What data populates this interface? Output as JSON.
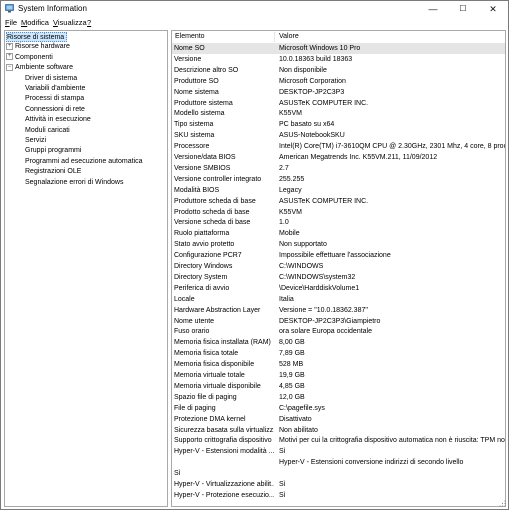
{
  "window": {
    "title": "System Information",
    "min": "—",
    "max": "☐",
    "close": "✕"
  },
  "menu": [
    {
      "u": "F",
      "rest": "ile"
    },
    {
      "u": "M",
      "rest": "odifica"
    },
    {
      "u": "V",
      "rest": "isualizza"
    },
    {
      "u": "?",
      "rest": ""
    }
  ],
  "tree": [
    {
      "label": "Risorse di sistema",
      "level": 0,
      "exp": "",
      "sel": true
    },
    {
      "label": "Risorse hardware",
      "level": 0,
      "exp": "+"
    },
    {
      "label": "Componenti",
      "level": 0,
      "exp": "+"
    },
    {
      "label": "Ambiente software",
      "level": 0,
      "exp": "−"
    },
    {
      "label": "Driver di sistema",
      "level": 1
    },
    {
      "label": "Variabili d'ambiente",
      "level": 1
    },
    {
      "label": "Processi di stampa",
      "level": 1
    },
    {
      "label": "Connessioni di rete",
      "level": 1
    },
    {
      "label": "Attività in esecuzione",
      "level": 1
    },
    {
      "label": "Moduli caricati",
      "level": 1
    },
    {
      "label": "Servizi",
      "level": 1
    },
    {
      "label": "Gruppi programmi",
      "level": 1
    },
    {
      "label": "Programmi ad esecuzione automatica",
      "level": 1
    },
    {
      "label": "Registrazioni OLE",
      "level": 1
    },
    {
      "label": "Segnalazione errori di Windows",
      "level": 1
    }
  ],
  "columns": {
    "key": "Elemento",
    "value": "Valore"
  },
  "rows": [
    [
      "Nome SO",
      "Microsoft Windows 10 Pro"
    ],
    [
      "Versione",
      "10.0.18363 build 18363"
    ],
    [
      "Descrizione altro SO",
      "Non disponibile"
    ],
    [
      "Produttore SO",
      "Microsoft Corporation"
    ],
    [
      "Nome sistema",
      "DESKTOP-JP2C3P3"
    ],
    [
      "Produttore sistema",
      "ASUSTeK COMPUTER INC."
    ],
    [
      "Modello sistema",
      "K55VM"
    ],
    [
      "Tipo sistema",
      "PC basato su x64"
    ],
    [
      "SKU sistema",
      "ASUS-NotebookSKU"
    ],
    [
      "Processore",
      "Intel(R) Core(TM) i7-3610QM CPU @ 2.30GHz, 2301 Mhz, 4 core, 8 proce"
    ],
    [
      "Versione/data BIOS",
      "American Megatrends Inc. K55VM.211, 11/09/2012"
    ],
    [
      "Versione SMBIOS",
      "2.7"
    ],
    [
      "Versione controller integrato",
      "255.255"
    ],
    [
      "Modalità BIOS",
      "Legacy"
    ],
    [
      "Produttore scheda di base",
      "ASUSTeK COMPUTER INC."
    ],
    [
      "Prodotto scheda di base",
      "K55VM"
    ],
    [
      "Versione scheda di base",
      "1.0"
    ],
    [
      "Ruolo piattaforma",
      "Mobile"
    ],
    [
      "Stato avvio protetto",
      "Non supportato"
    ],
    [
      "Configurazione PCR7",
      "Impossibile effettuare l'associazione"
    ],
    [
      "Directory Windows",
      "C:\\WINDOWS"
    ],
    [
      "Directory System",
      "C:\\WINDOWS\\system32"
    ],
    [
      "Periferica di avvio",
      "\\Device\\HarddiskVolume1"
    ],
    [
      "Locale",
      "Italia"
    ],
    [
      "Hardware Abstraction Layer",
      "Versione = \"10.0.18362.387\""
    ],
    [
      "Nome utente",
      "DESKTOP-JP2C3P3\\Giampietro"
    ],
    [
      "Fuso orario",
      "ora solare Europa occidentale"
    ],
    [
      "Memoria fisica installata (RAM)",
      "8,00 GB"
    ],
    [
      "Memoria fisica totale",
      "7,89 GB"
    ],
    [
      "Memoria fisica disponibile",
      "528 MB"
    ],
    [
      "Memoria virtuale totale",
      "19,9 GB"
    ],
    [
      "Memoria virtuale disponibile",
      "4,85 GB"
    ],
    [
      "Spazio file di paging",
      "12,0 GB"
    ],
    [
      "File di paging",
      "C:\\pagefile.sys"
    ],
    [
      "Protezione DMA kernel",
      "Disattivato"
    ],
    [
      "Sicurezza basata sulla virtualizz...",
      "Non abilitato"
    ],
    [
      "Supporto crittografia dispositivo",
      "Motivi per cui la crittografia dispositivo automatica non è riuscita: TPM no"
    ],
    [
      "Hyper-V - Estensioni modalità ...",
      "Sì"
    ],
    [
      "",
      "Hyper-V - Estensioni conversione indirizzi di secondo livello"
    ],
    [
      "Sì",
      ""
    ],
    [
      "Hyper-V - Virtualizzazione abilit...",
      "Sì"
    ],
    [
      "Hyper-V - Protezione esecuzio...",
      "Sì"
    ]
  ]
}
